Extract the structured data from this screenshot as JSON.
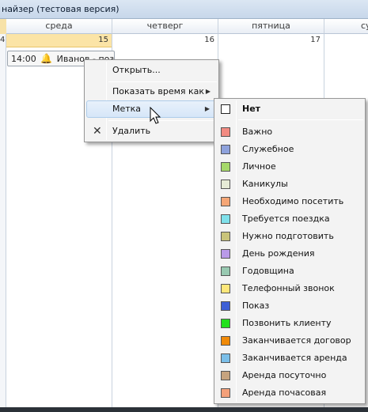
{
  "window": {
    "title": "найзер (тестовая версия)"
  },
  "calendar": {
    "left_day_number": "4",
    "columns": [
      {
        "name": "среда",
        "number": "15",
        "today": true
      },
      {
        "name": "четверг",
        "number": "16",
        "today": false
      },
      {
        "name": "пятница",
        "number": "17",
        "today": false
      },
      {
        "name": "су",
        "number": "",
        "today": false
      }
    ],
    "event": {
      "time": "14:00",
      "text": "Иванов - позво"
    }
  },
  "context_menu": {
    "open_label": "Открыть...",
    "show_time_label": "Показать время как",
    "label_label": "Метка",
    "delete_label": "Удалить"
  },
  "label_submenu": {
    "items": [
      {
        "label": "Нет",
        "color": "#ffffff",
        "bold": true
      },
      {
        "label": "Важно",
        "color": "#f28b82"
      },
      {
        "label": "Служебное",
        "color": "#8ea2dc"
      },
      {
        "label": "Личное",
        "color": "#a6d96a"
      },
      {
        "label": "Каникулы",
        "color": "#e6ebd6"
      },
      {
        "label": "Необходимо посетить",
        "color": "#f5a676"
      },
      {
        "label": "Требуется поездка",
        "color": "#7fe0ea"
      },
      {
        "label": "Нужно подготовить",
        "color": "#c9c47a"
      },
      {
        "label": "День рождения",
        "color": "#b99ae8"
      },
      {
        "label": "Годовщина",
        "color": "#98c9b1"
      },
      {
        "label": "Телефонный звонок",
        "color": "#fde77a"
      },
      {
        "label": "Показ",
        "color": "#3d5fd6"
      },
      {
        "label": "Позвонить клиенту",
        "color": "#22e11c"
      },
      {
        "label": "Заканчивается договор",
        "color": "#f08a08"
      },
      {
        "label": "Заканчивается аренда",
        "color": "#7bbfe9"
      },
      {
        "label": "Аренда посуточно",
        "color": "#c6a37e"
      },
      {
        "label": "Аренда почасовая",
        "color": "#f3a07a"
      }
    ]
  }
}
